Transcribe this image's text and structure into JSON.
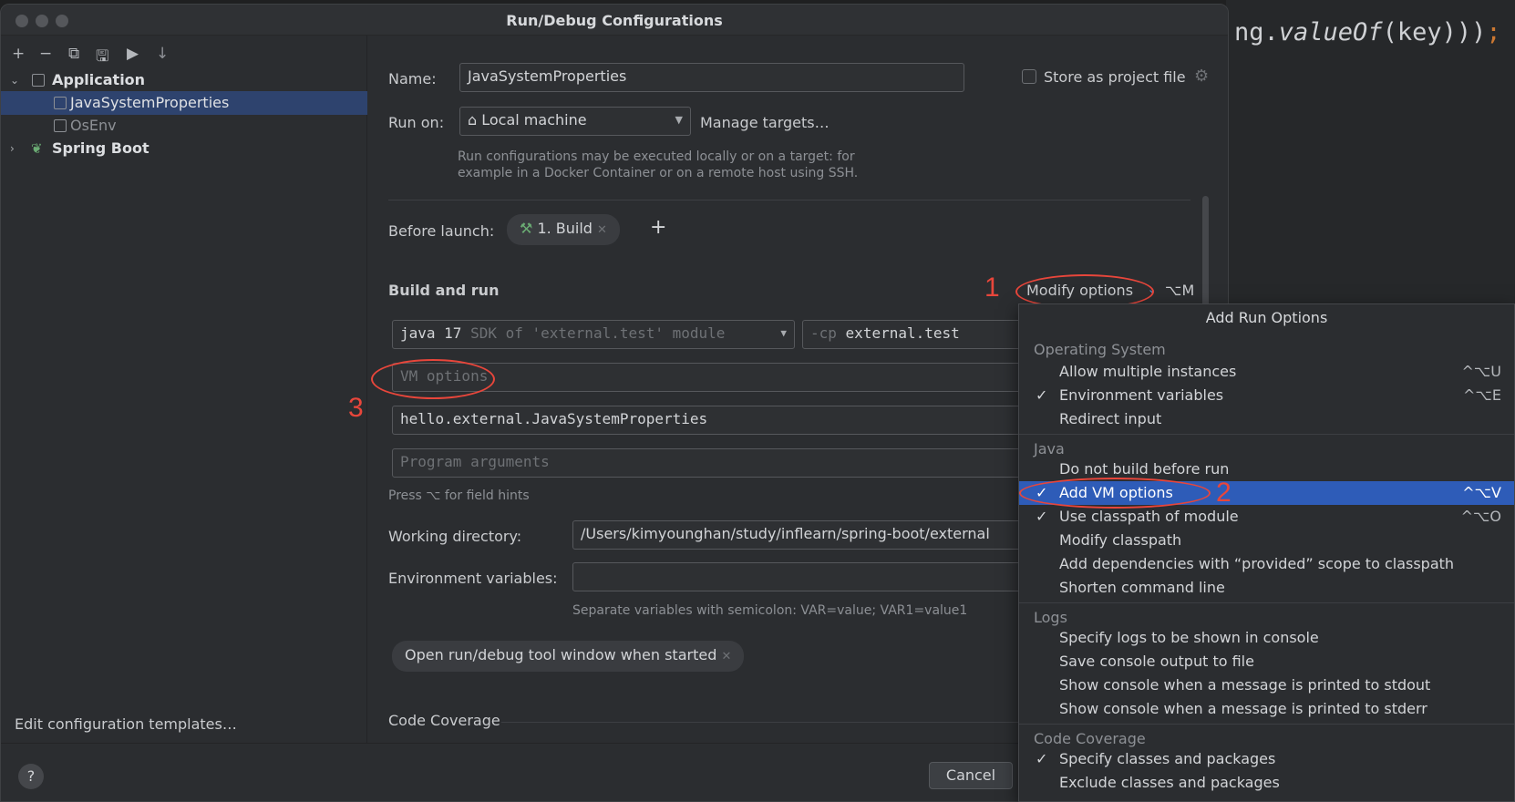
{
  "editor": {
    "code_prefix": "ng.",
    "code_italic": "valueOf",
    "code_suffix": "(key)))",
    "code_semi": ";"
  },
  "dialog": {
    "title": "Run/Debug Configurations"
  },
  "sidebar": {
    "toolbar": [
      "+",
      "−",
      "⧉",
      "🖫",
      "▶",
      "↓"
    ],
    "tree": [
      {
        "label": "Application",
        "expanded": true
      },
      {
        "label": "JavaSystemProperties",
        "selected": true
      },
      {
        "label": "OsEnv"
      },
      {
        "label": "Spring Boot",
        "expanded": false
      }
    ],
    "edit_templates": "Edit configuration templates…"
  },
  "form": {
    "name_label": "Name:",
    "name_value": "JavaSystemProperties",
    "store_label": "Store as project file",
    "runon_label": "Run on:",
    "runon_value": "Local machine",
    "manage_targets": "Manage targets…",
    "runon_hint_1": "Run configurations may be executed locally or on a target: for",
    "runon_hint_2": "example in a Docker Container or on a remote host using SSH.",
    "before_launch_label": "Before launch:",
    "build_chip": "1. Build",
    "build_and_run": "Build and run",
    "modify_options": "Modify options",
    "modify_shortcut": "⌥M",
    "sdk_main": "java 17",
    "sdk_sub": "SDK of 'external.test' module",
    "cp_prefix": "-cp",
    "cp_value": "external.test",
    "vm_placeholder": "VM options",
    "main_class": "hello.external.JavaSystemProperties",
    "args_placeholder": "Program arguments",
    "field_hints": "Press ⌥ for field hints",
    "workdir_label": "Working directory:",
    "workdir_value": "/Users/kimyounghan/study/inflearn/spring-boot/external",
    "env_label": "Environment variables:",
    "env_hint": "Separate variables with semicolon: VAR=value; VAR1=value1",
    "open_window_chip": "Open run/debug tool window when started",
    "code_coverage": "Code Coverage"
  },
  "annotations": [
    "1",
    "2",
    "3"
  ],
  "footer": {
    "help": "?",
    "cancel": "Cancel"
  },
  "popup": {
    "title": "Add Run Options",
    "groups": [
      {
        "heading": "Operating System",
        "items": [
          {
            "label": "Allow multiple instances",
            "shortcut": "^⌥U",
            "checked": false
          },
          {
            "label": "Environment variables",
            "shortcut": "^⌥E",
            "checked": true
          },
          {
            "label": "Redirect input",
            "shortcut": "",
            "checked": false
          }
        ]
      },
      {
        "heading": "Java",
        "items": [
          {
            "label": "Do not build before run",
            "shortcut": "",
            "checked": false
          },
          {
            "label": "Add VM options",
            "shortcut": "^⌥V",
            "checked": true,
            "selected": true
          },
          {
            "label": "Use classpath of module",
            "shortcut": "^⌥O",
            "checked": true
          },
          {
            "label": "Modify classpath",
            "shortcut": "",
            "checked": false
          },
          {
            "label": "Add dependencies with “provided” scope to classpath",
            "shortcut": "",
            "checked": false
          },
          {
            "label": "Shorten command line",
            "shortcut": "",
            "checked": false
          }
        ]
      },
      {
        "heading": "Logs",
        "items": [
          {
            "label": "Specify logs to be shown in console",
            "shortcut": "",
            "checked": false
          },
          {
            "label": "Save console output to file",
            "shortcut": "",
            "checked": false
          },
          {
            "label": "Show console when a message is printed to stdout",
            "shortcut": "",
            "checked": false
          },
          {
            "label": "Show console when a message is printed to stderr",
            "shortcut": "",
            "checked": false
          }
        ]
      },
      {
        "heading": "Code Coverage",
        "items": [
          {
            "label": "Specify classes and packages",
            "shortcut": "",
            "checked": true
          },
          {
            "label": "Exclude classes and packages",
            "shortcut": "",
            "checked": false
          }
        ]
      }
    ]
  },
  "colors": {
    "accent_link": "#5c9ce8",
    "selection": "#2e5cb8",
    "annotation": "#e8463b"
  }
}
